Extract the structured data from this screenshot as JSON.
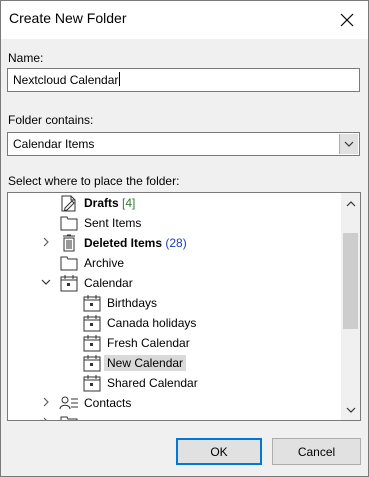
{
  "window": {
    "title": "Create New Folder"
  },
  "name_field": {
    "label": "Name:",
    "value": "Nextcloud Calendar"
  },
  "contains_field": {
    "label": "Folder contains:",
    "value": "Calendar Items"
  },
  "tree": {
    "label": "Select where to place the folder:",
    "items": [
      {
        "label": "Drafts",
        "count": "[4]"
      },
      {
        "label": "Sent Items"
      },
      {
        "label": "Deleted Items",
        "count": "(28)"
      },
      {
        "label": "Archive"
      },
      {
        "label": "Calendar"
      },
      {
        "label": "Birthdays"
      },
      {
        "label": "Canada holidays"
      },
      {
        "label": "Fresh Calendar"
      },
      {
        "label": "New Calendar"
      },
      {
        "label": "Shared Calendar"
      },
      {
        "label": "Contacts"
      }
    ]
  },
  "buttons": {
    "ok": "OK",
    "cancel": "Cancel"
  },
  "colors": {
    "accent": "#0078d7",
    "count_green": "#2e7d32",
    "count_blue": "#1a3fb5"
  }
}
